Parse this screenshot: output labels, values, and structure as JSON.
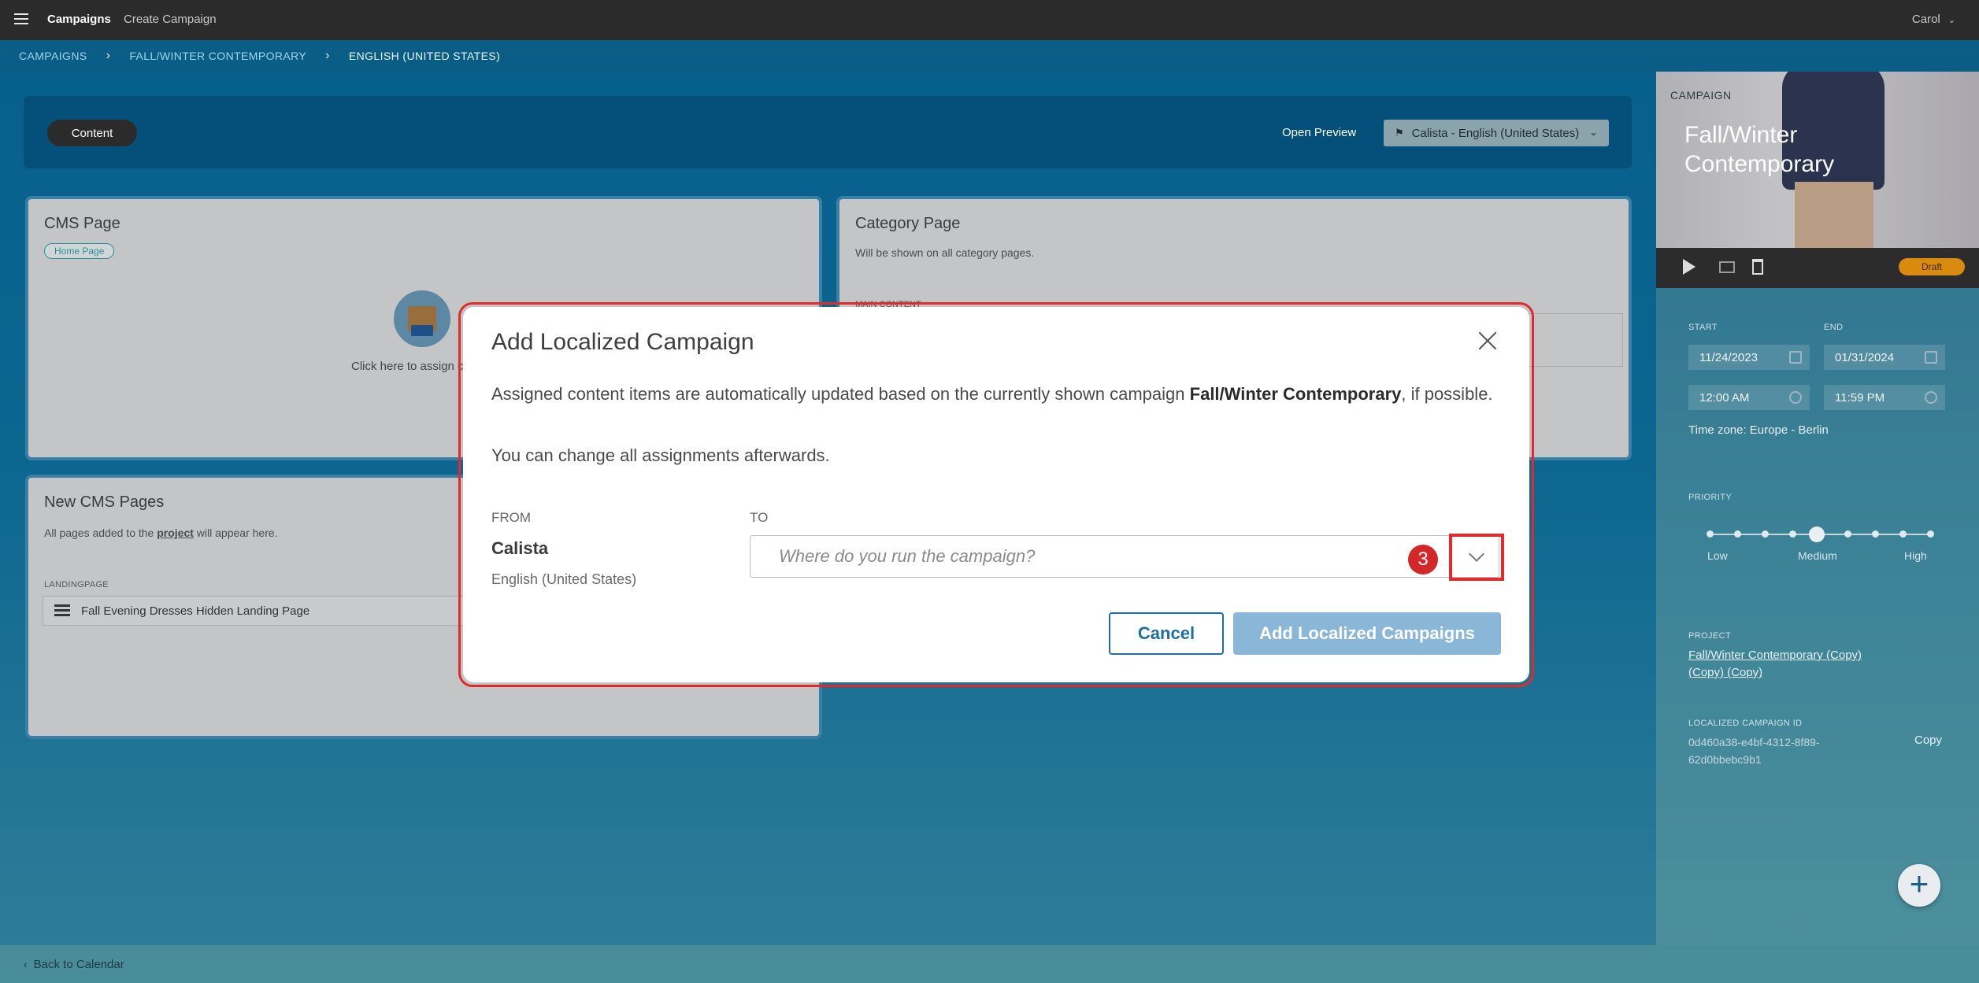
{
  "topbar": {
    "menu_icon": "hamburger-icon",
    "app_title": "Campaigns",
    "create_link": "Create Campaign",
    "user": "Carol"
  },
  "breadcrumb": {
    "items": [
      "CAMPAIGNS",
      "FALL/WINTER CONTEMPORARY",
      "ENGLISH (UNITED STATES)"
    ],
    "separator": "›"
  },
  "header": {
    "content_tab": "Content",
    "open_preview": "Open Preview",
    "locale_select": "Calista - English (United States)"
  },
  "cards": {
    "cms_page": {
      "title": "CMS Page",
      "tag": "Home Page",
      "assign_text": "Click here to assign c"
    },
    "category_page": {
      "title": "Category Page",
      "subtitle": "Will be shown on all category pages.",
      "main_content_label": "MAIN CONTENT"
    },
    "new_cms_pages": {
      "title": "New CMS Pages",
      "subtitle_pre": "All pages added to the ",
      "subtitle_link": "project",
      "subtitle_post": " will appear here.",
      "landing_label": "LANDINGPAGE",
      "landing_value": "Fall Evening Dresses Hidden Landing Page"
    }
  },
  "sidebar": {
    "campaign_label": "CAMPAIGN",
    "campaign_title_1": "Fall/Winter",
    "campaign_title_2": "Contemporary",
    "status": "Draft",
    "start_label": "START",
    "end_label": "END",
    "start_date": "11/24/2023",
    "end_date": "01/31/2024",
    "start_time": "12:00 AM",
    "end_time": "11:59 PM",
    "timezone": "Time zone: Europe - Berlin",
    "priority_label": "PRIORITY",
    "priority_low": "Low",
    "priority_medium": "Medium",
    "priority_high": "High",
    "priority_level": "Medium",
    "project_label": "PROJECT",
    "project_line1": "Fall/Winter Contemporary (Copy)",
    "project_line2": "(Copy) (Copy)",
    "id_label": "LOCALIZED CAMPAIGN ID",
    "id_line1": "0d460a38-e4bf-4312-8f89-",
    "id_line2": "62d0bbebc9b1",
    "copy": "Copy",
    "fab": "+"
  },
  "footer": {
    "back": "Back to Calendar"
  },
  "dialog": {
    "title": "Add Localized Campaign",
    "p1_pre": "Assigned content items are automatically updated based on the currently shown campaign ",
    "p1_bold": "Fall/Winter Contemporary",
    "p1_post": ", if possible.",
    "p2": "You can change all assignments afterwards.",
    "from_label": "FROM",
    "to_label": "TO",
    "from_name": "Calista",
    "from_locale": "English (United States)",
    "to_placeholder": "Where do you run the campaign?",
    "badge": "3",
    "cancel": "Cancel",
    "add": "Add Localized Campaigns"
  },
  "colors": {
    "highlight": "#e12b2b",
    "primary": "#1d6fa5",
    "draft": "#d98b0e"
  }
}
